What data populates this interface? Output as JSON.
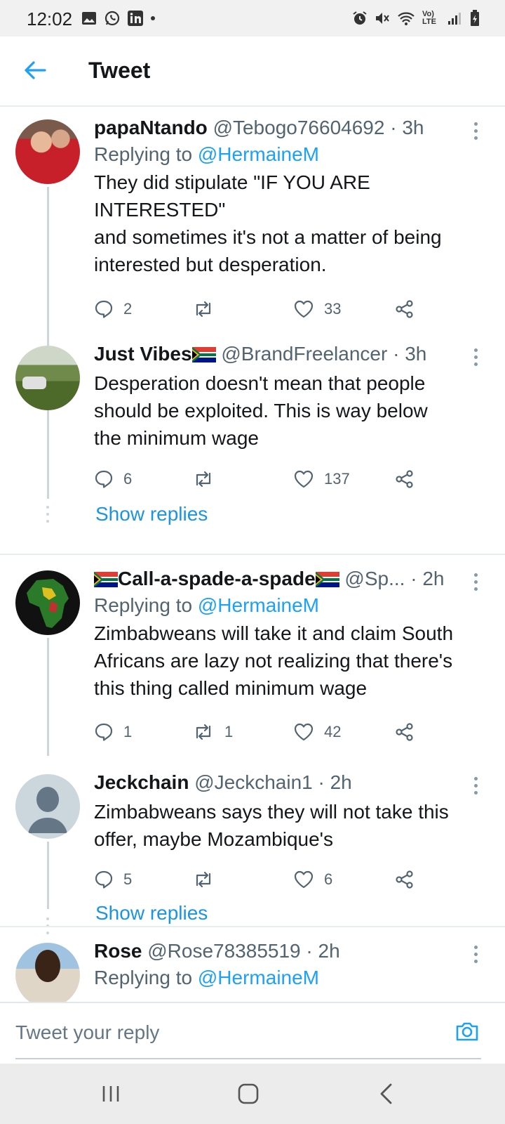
{
  "status_bar": {
    "time": "12:02",
    "network": "Vo) LTE"
  },
  "header": {
    "title": "Tweet"
  },
  "tweets": [
    {
      "name": "papaNtando",
      "handle": "@Tebogo76604692",
      "time": "· 3h",
      "replying_prefix": "Replying to ",
      "replying_to": "@HermaineM",
      "text_lines": [
        "They did stipulate \"IF YOU ARE",
        "INTERESTED\"",
        "and sometimes it's not a matter of being",
        "interested but desperation."
      ],
      "replies": "2",
      "retweets": "",
      "likes": "33"
    },
    {
      "name": "Just Vibes",
      "handle": "@BrandFreelancer",
      "time": "· 3h",
      "text_lines": [
        "Desperation doesn't mean that people",
        "should be exploited. This is way below",
        "the minimum wage"
      ],
      "replies": "6",
      "retweets": "",
      "likes": "137"
    },
    {
      "name": "Call-a-spade-a-spade",
      "handle": "@Sp...",
      "time": "· 2h",
      "replying_prefix": "Replying to ",
      "replying_to": "@HermaineM",
      "text_lines": [
        "Zimbabweans will take it and claim South",
        "Africans are lazy not realizing that there's",
        "this thing called minimum wage"
      ],
      "replies": "1",
      "retweets": "1",
      "likes": "42"
    },
    {
      "name": "Jeckchain",
      "handle": "@Jeckchain1",
      "time": "· 2h",
      "text_lines": [
        "Zimbabweans says they will not take this",
        "offer, maybe Mozambique's"
      ],
      "replies": "5",
      "retweets": "",
      "likes": "6"
    },
    {
      "name": "Rose",
      "handle": "@Rose78385519",
      "time": "· 2h",
      "replying_prefix": "Replying to ",
      "replying_to": "@HermaineM"
    }
  ],
  "show_replies_label": "Show replies",
  "reply_bar": {
    "placeholder": "Tweet your reply"
  },
  "colors": {
    "accent": "#1da1f2",
    "text": "#14171a",
    "secondary": "#536471",
    "divider": "#e6ecf0"
  }
}
